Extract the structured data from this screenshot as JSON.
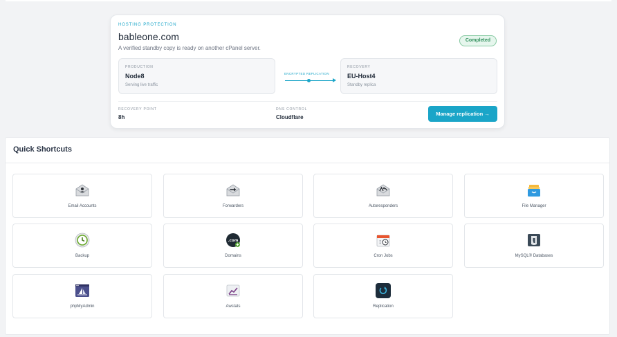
{
  "protection": {
    "eyebrow": "HOSTING PROTECTION",
    "domain": "bableone.com",
    "description": "A verified standby copy is ready on another cPanel server.",
    "status": "Completed",
    "production": {
      "label": "PRODUCTION",
      "name": "Node8",
      "sub": "Serving live traffic"
    },
    "recovery": {
      "label": "RECOVERY",
      "name": "EU-Host4",
      "sub": "Standby replica"
    },
    "link_label": "ENCRYPTED REPLICATION",
    "recovery_point": {
      "label": "RECOVERY POINT",
      "value": "8h"
    },
    "dns_control": {
      "label": "DNS CONTROL",
      "value": "Cloudflare"
    },
    "action": "Manage replication →"
  },
  "shortcuts": {
    "title": "Quick Shortcuts",
    "items": [
      {
        "label": "Email Accounts",
        "icon": "email-accounts-icon"
      },
      {
        "label": "Forwarders",
        "icon": "forwarders-icon"
      },
      {
        "label": "Autoresponders",
        "icon": "autoresponders-icon"
      },
      {
        "label": "File Manager",
        "icon": "file-manager-icon"
      },
      {
        "label": "Backup",
        "icon": "backup-icon"
      },
      {
        "label": "Domains",
        "icon": "domains-icon"
      },
      {
        "label": "Cron Jobs",
        "icon": "cron-jobs-icon"
      },
      {
        "label": "MySQL® Databases",
        "icon": "mysql-databases-icon"
      },
      {
        "label": "phpMyAdmin",
        "icon": "phpmyadmin-icon"
      },
      {
        "label": "Awstats",
        "icon": "awstats-icon"
      },
      {
        "label": "Replication",
        "icon": "replication-icon"
      }
    ]
  },
  "colors": {
    "accent": "#1aa5c8",
    "success": "#2f8f5b",
    "text": "#2d3748"
  }
}
